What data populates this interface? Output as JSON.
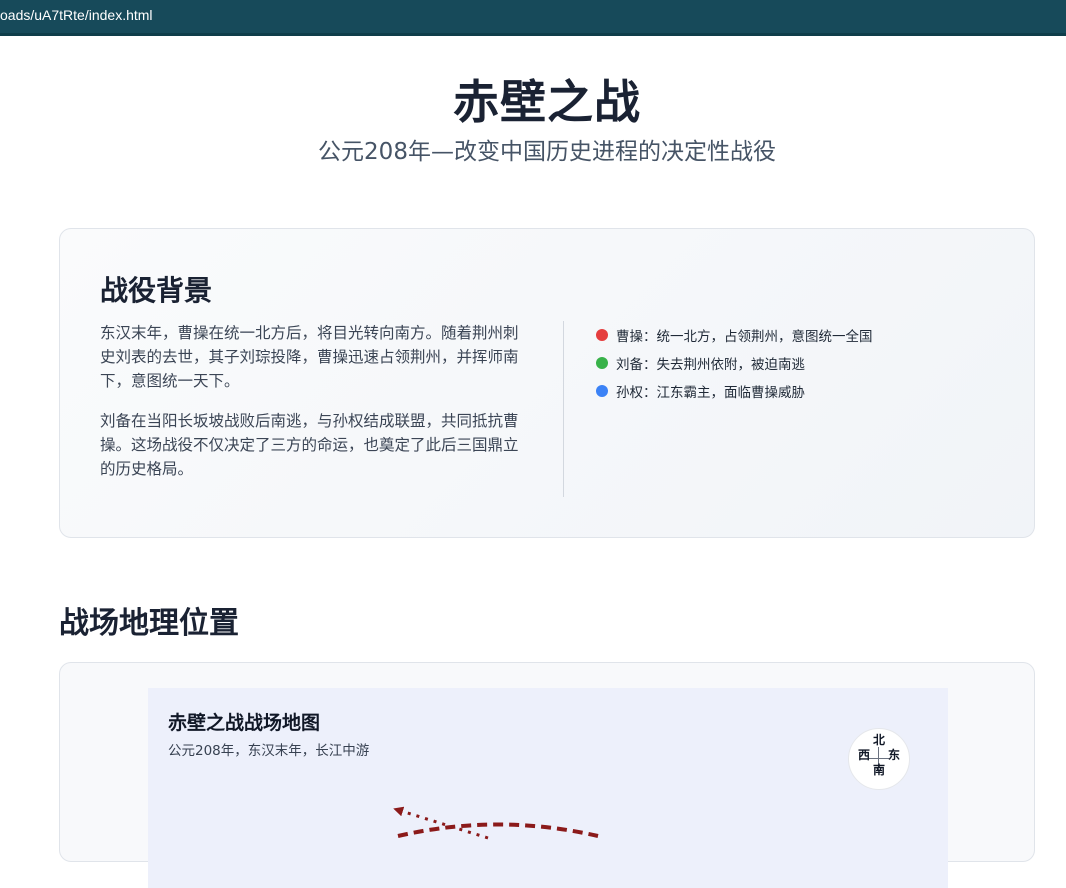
{
  "browser": {
    "url": "oads/uA7tRte/index.html"
  },
  "header": {
    "title": "赤壁之战",
    "subtitle": "公元208年—改变中国历史进程的决定性战役"
  },
  "background": {
    "heading": "战役背景",
    "paragraphs": [
      "东汉末年，曹操在统一北方后，将目光转向南方。随着荆州刺史刘表的去世，其子刘琮投降，曹操迅速占领荆州，并挥师南下，意图统一天下。",
      "刘备在当阳长坂坡战败后南逃，与孙权结成联盟，共同抵抗曹操。这场战役不仅决定了三方的命运，也奠定了此后三国鼎立的历史格局。"
    ],
    "factions": [
      {
        "label": "曹操：统一北方，占领荆州，意图统一全国",
        "color": "#e53e3e"
      },
      {
        "label": "刘备：失去荆州依附，被迫南逃",
        "color": "#38b249"
      },
      {
        "label": "孙权：江东霸主，面临曹操威胁",
        "color": "#3b82f6"
      }
    ]
  },
  "geography": {
    "heading": "战场地理位置",
    "map": {
      "title": "赤壁之战战场地图",
      "subtitle": "公元208年，东汉末年，长江中游",
      "compass": {
        "north": "北",
        "south": "南",
        "west": "西",
        "east": "东"
      },
      "route_color": "#8b1a1a",
      "background_color": "#edf0fb"
    }
  }
}
